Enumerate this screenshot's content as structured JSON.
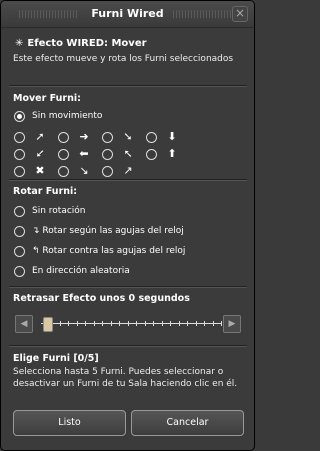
{
  "window": {
    "title": "Furni Wired",
    "close_glyph": "×"
  },
  "effect": {
    "title": "Efecto WIRED: Mover",
    "description": "Este efecto mueve y rota los Furni seleccionados"
  },
  "move": {
    "heading": "Mover Furni:",
    "none_label": "Sin movimiento",
    "rows": [
      [
        "diag-up-right",
        "right",
        "diag-down-right",
        "down"
      ],
      [
        "diag-down-left",
        "left",
        "diag-up-left",
        "up"
      ],
      [
        "random",
        "horizontal",
        "diagonal-other"
      ]
    ]
  },
  "rotate": {
    "heading": "Rotar Furni:",
    "options": [
      {
        "label": "Sin rotación",
        "icon": ""
      },
      {
        "label": "Rotar según las agujas del reloj",
        "icon": "↴"
      },
      {
        "label": "Rotar contra las agujas del reloj",
        "icon": "↰"
      },
      {
        "label": "En dirección aleatoria",
        "icon": ""
      }
    ]
  },
  "delay": {
    "label": "Retrasar Efecto unos 0 segundos",
    "value": 0,
    "left_glyph": "◀",
    "right_glyph": "▶"
  },
  "select": {
    "heading": "Elige Furni [0/5]",
    "text": "Selecciona hasta 5 Furni. Puedes seleccionar o desactivar un Furni de tu Sala haciendo clic en él."
  },
  "buttons": {
    "ok": "Listo",
    "cancel": "Cancelar"
  },
  "arrow_glyphs": {
    "diag-up-right": "➚",
    "right": "➜",
    "diag-down-right": "➘",
    "down": "⬇",
    "diag-down-left": "➘",
    "left": "⬅",
    "diag-up-left": "➚",
    "up": "⬆",
    "random": "✖",
    "horizontal": "↘",
    "diagonal-other": "↗"
  }
}
